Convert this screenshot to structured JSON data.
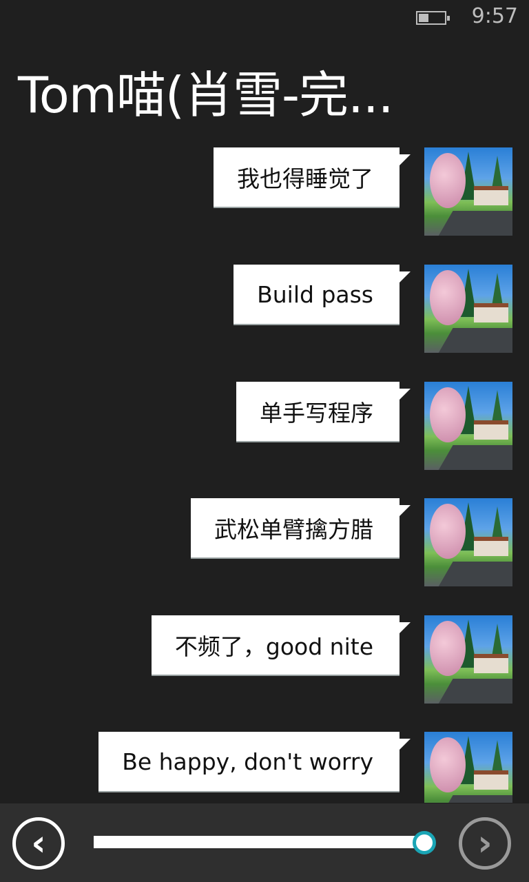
{
  "status_bar": {
    "time": "9:57",
    "battery_level": 0.4
  },
  "header": {
    "title": "Tom喵(肖雪-完..."
  },
  "messages": [
    {
      "text": "我也得睡觉了",
      "avatar": "landscape-avatar"
    },
    {
      "text": "Build pass",
      "avatar": "landscape-avatar"
    },
    {
      "text": "单手写程序",
      "avatar": "landscape-avatar"
    },
    {
      "text": "武松单臂擒方腊",
      "avatar": "landscape-avatar"
    },
    {
      "text": "不频了，good nite",
      "avatar": "landscape-avatar"
    },
    {
      "text": "Be happy, don't worry",
      "avatar": "landscape-avatar"
    }
  ],
  "playback": {
    "progress": 0.96,
    "prev_icon": "chevron-left-icon",
    "next_icon": "chevron-right-icon"
  },
  "colors": {
    "background": "#1f1f1f",
    "bottom_bar": "#2f2f2f",
    "accent": "#1aa5b5",
    "bubble": "#ffffff"
  }
}
